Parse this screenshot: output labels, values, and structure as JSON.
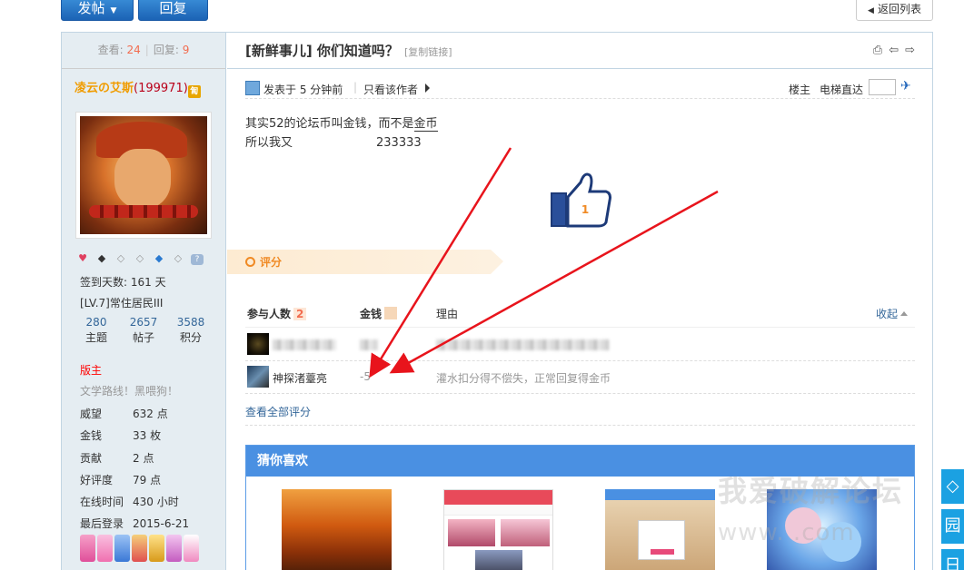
{
  "toolbar": {
    "post_label": "发帖",
    "reply_label": "回复",
    "back_label": "返回列表"
  },
  "sidebar": {
    "views_label": "查看:",
    "views": "24",
    "replies_label": "回复:",
    "replies": "9",
    "author_name": "凌云の艾斯",
    "author_uid": "(199971)",
    "checkin_days": "签到天数: 161 天",
    "level": "[LV.7]常住居民III",
    "counts": [
      {
        "value": "280",
        "label": "主题"
      },
      {
        "value": "2657",
        "label": "帖子"
      },
      {
        "value": "3588",
        "label": "积分"
      }
    ],
    "role": "版主",
    "motto": "文学路线！黑喂狗！",
    "info": [
      {
        "key": "威望",
        "value": "632 点"
      },
      {
        "key": "金钱",
        "value": "33 枚"
      },
      {
        "key": "贡献",
        "value": "2 点"
      },
      {
        "key": "好评度",
        "value": "79 点"
      },
      {
        "key": "在线时间",
        "value": "430 小时"
      },
      {
        "key": "最后登录",
        "value": "2015-6-21"
      }
    ]
  },
  "post": {
    "title": "[新鲜事儿] 你们知道吗？",
    "copy_link": "[复制链接]",
    "posted": "发表于 5 分钟前",
    "sep": "|",
    "only_author": "只看该作者",
    "floor": "楼主",
    "jump": "电梯直达",
    "line1_prefix": "其实52的论坛币叫金钱，而不是",
    "line1_link": "金币",
    "line2_a": "所以我又",
    "line2_b": "233333",
    "thumb_count": "1"
  },
  "rating": {
    "label": "评分",
    "participants_label": "参与人数",
    "participants": "2",
    "money_label": "金钱",
    "reason_label": "理由",
    "collapse_label": "收起",
    "rows": [
      {
        "name": "",
        "value": "",
        "reason": ""
      },
      {
        "name": "神探渚薹亮",
        "value": "-5",
        "reason": "灌水扣分得不偿失，正常回复得金币"
      }
    ],
    "view_all": "查看全部评分"
  },
  "guess": {
    "title": "猜你喜欢"
  },
  "watermark": {
    "text": "我爱破解论坛",
    "url": "www.  .com"
  },
  "side_tabs": [
    "◇",
    "园",
    "日"
  ]
}
